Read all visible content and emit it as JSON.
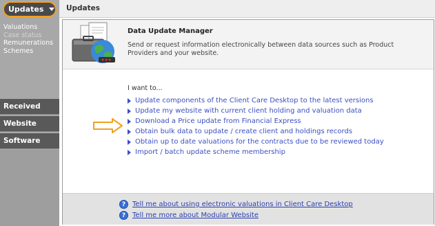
{
  "sidebar": {
    "updates_tab_label": "Updates",
    "sub_items": [
      "Valuations",
      "Case status",
      "Remunerations",
      "Schemes"
    ],
    "sections": [
      "Received",
      "Website",
      "Software"
    ]
  },
  "header": {
    "title": "Updates"
  },
  "intro": {
    "title": "Data Update Manager",
    "text": "Send or request information electronically between data sources such as Product Providers and your website."
  },
  "main": {
    "prompt": "I want to...",
    "options": [
      "Update components of the Client Care Desktop to the latest versions",
      "Update my website with current client holding and valuation data",
      "Download a Price update from Financial Express",
      "Obtain bulk data to update / create client and holdings records",
      "Obtain up to date valuations for the contracts due to be reviewed today",
      "Import / batch update scheme membership"
    ]
  },
  "footer": {
    "links": [
      "Tell me about using electronic valuations in Client Care Desktop",
      "Tell me more about Modular Website"
    ]
  },
  "colors": {
    "link": "#3a4fc0",
    "highlight": "#f0a020",
    "sidebar": "#a8a8a8",
    "sidebar_section": "#595959"
  }
}
